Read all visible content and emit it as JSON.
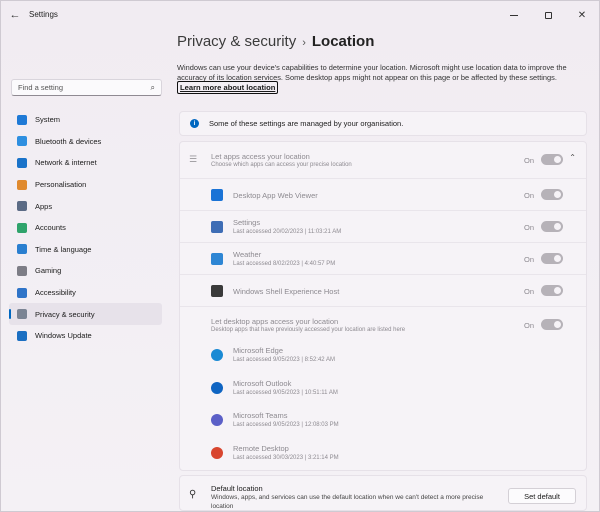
{
  "window": {
    "title": "Settings"
  },
  "sidebar": {
    "search_placeholder": "Find a setting",
    "items": [
      {
        "label": "System",
        "icon": "system-icon",
        "color": "#1f7ad6"
      },
      {
        "label": "Bluetooth & devices",
        "icon": "bluetooth-icon",
        "color": "#2e8fe0"
      },
      {
        "label": "Network & internet",
        "icon": "wifi-icon",
        "color": "#1a73c9"
      },
      {
        "label": "Personalisation",
        "icon": "brush-icon",
        "color": "#e08a2e"
      },
      {
        "label": "Apps",
        "icon": "apps-icon",
        "color": "#5b6b85"
      },
      {
        "label": "Accounts",
        "icon": "accounts-icon",
        "color": "#2fa36b"
      },
      {
        "label": "Time & language",
        "icon": "globe-icon",
        "color": "#2a7fd0"
      },
      {
        "label": "Gaming",
        "icon": "gamepad-icon",
        "color": "#7d7d86"
      },
      {
        "label": "Accessibility",
        "icon": "accessibility-icon",
        "color": "#2f74c8"
      },
      {
        "label": "Privacy & security",
        "icon": "shield-icon",
        "color": "#7b8494"
      },
      {
        "label": "Windows Update",
        "icon": "update-icon",
        "color": "#1b6fc2"
      }
    ],
    "active_index": 9
  },
  "header": {
    "parent": "Privacy & security",
    "separator": "›",
    "current": "Location"
  },
  "description": "Windows can use your device's capabilities to determine your location. Microsoft might use location data to improve the accuracy of its location services. Some desktop apps might not appear on this page or be affected by these settings.",
  "learn_more": "Learn more about location",
  "banner": "Some of these settings are managed by your organisation.",
  "apps_access": {
    "title": "Let apps access your location",
    "subtitle": "Choose which apps can access your precise location",
    "state": "On"
  },
  "apps": [
    {
      "name": "Desktop App Web Viewer",
      "last": "",
      "state": "On",
      "icon": "webviewer-icon",
      "color": "#1a73d6"
    },
    {
      "name": "Settings",
      "last": "Last accessed 20/02/2023  |  11:03:21 AM",
      "state": "On",
      "icon": "settings-gear-icon",
      "color": "#3e6db5"
    },
    {
      "name": "Weather",
      "last": "Last accessed 8/02/2023  |  4:40:57 PM",
      "state": "On",
      "icon": "weather-icon",
      "color": "#2e86d4"
    },
    {
      "name": "Windows Shell Experience Host",
      "last": "",
      "state": "On",
      "icon": "shell-host-icon",
      "color": "#3a3a3a"
    }
  ],
  "desktop_access": {
    "title": "Let desktop apps access your location",
    "subtitle": "Desktop apps that have previously accessed your location are listed here",
    "state": "On"
  },
  "desktop_apps": [
    {
      "name": "Microsoft Edge",
      "last": "Last accessed 9/05/2023  |  8:52:42 AM",
      "icon": "edge-icon",
      "color": "#1a8ad4"
    },
    {
      "name": "Microsoft Outlook",
      "last": "Last accessed 9/05/2023  |  10:51:11 AM",
      "icon": "outlook-icon",
      "color": "#0f64c2"
    },
    {
      "name": "Microsoft Teams",
      "last": "Last accessed 9/05/2023  |  12:08:03 PM",
      "icon": "teams-icon",
      "color": "#5b5fc7"
    },
    {
      "name": "Remote Desktop",
      "last": "Last accessed 30/03/2023  |  3:21:14 PM",
      "icon": "remote-desktop-icon",
      "color": "#d8452f"
    }
  ],
  "default_location": {
    "title": "Default location",
    "subtitle": "Windows, apps, and services can use the default location when we can't detect a more precise location",
    "button": "Set default"
  }
}
